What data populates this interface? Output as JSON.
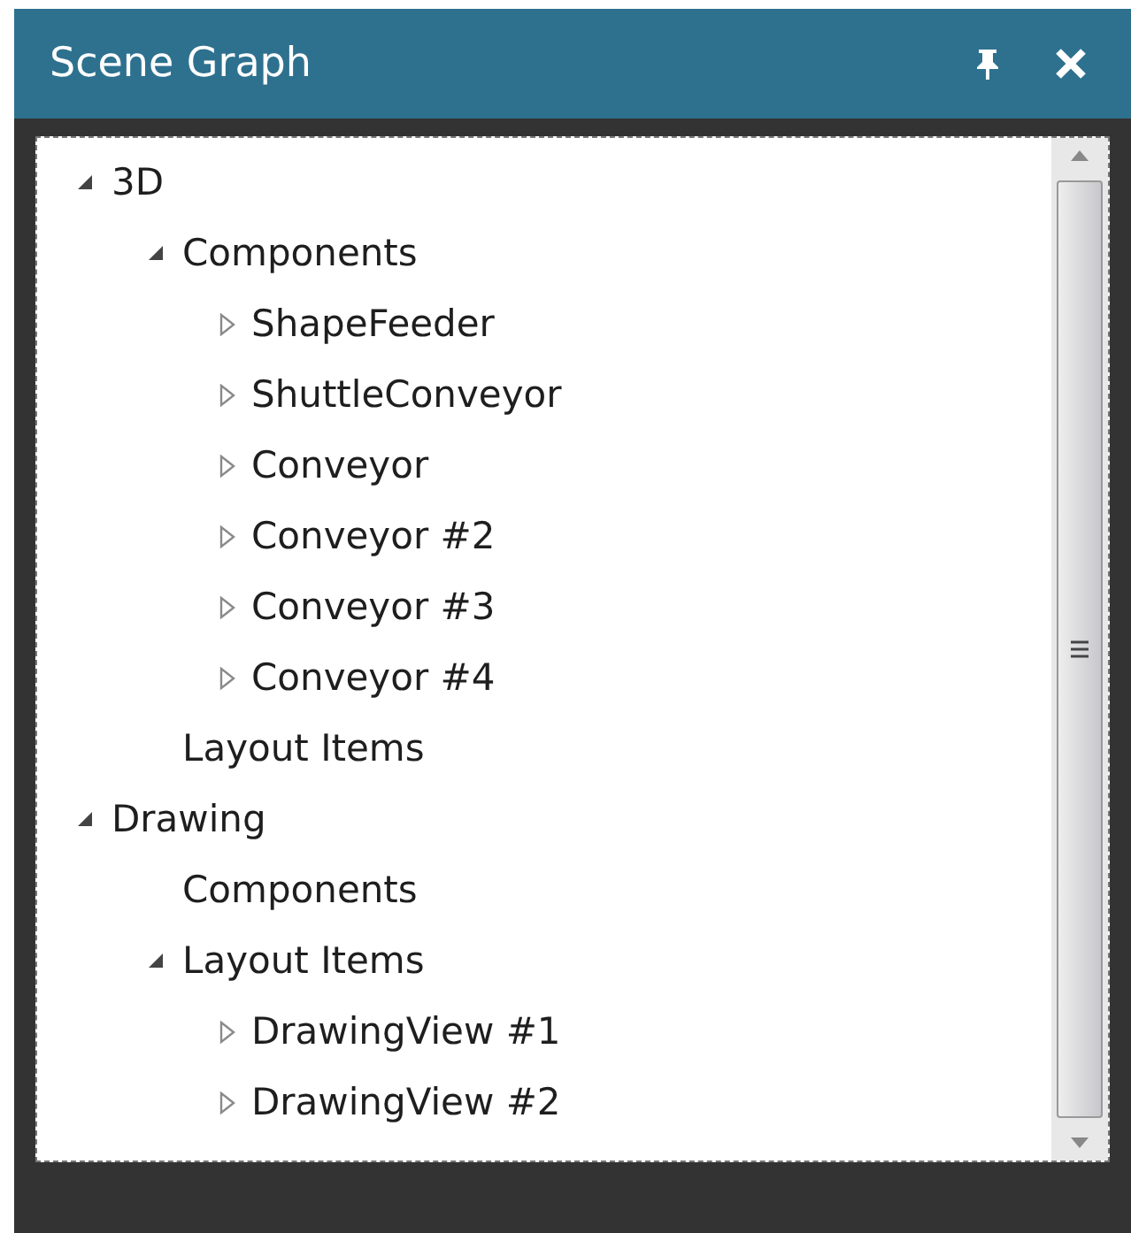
{
  "panel": {
    "title": "Scene Graph"
  },
  "tree": [
    {
      "label": "3D",
      "expanded": true,
      "children": [
        {
          "label": "Components",
          "expanded": true,
          "children": [
            {
              "label": "ShapeFeeder",
              "expanded": false
            },
            {
              "label": "ShuttleConveyor",
              "expanded": false
            },
            {
              "label": "Conveyor",
              "expanded": false
            },
            {
              "label": "Conveyor #2",
              "expanded": false
            },
            {
              "label": "Conveyor #3",
              "expanded": false
            },
            {
              "label": "Conveyor #4",
              "expanded": false
            }
          ]
        },
        {
          "label": "Layout Items"
        }
      ]
    },
    {
      "label": "Drawing",
      "expanded": true,
      "children": [
        {
          "label": "Components"
        },
        {
          "label": "Layout Items",
          "expanded": true,
          "children": [
            {
              "label": "DrawingView #1",
              "expanded": false
            },
            {
              "label": "DrawingView #2",
              "expanded": false
            }
          ]
        }
      ]
    }
  ]
}
